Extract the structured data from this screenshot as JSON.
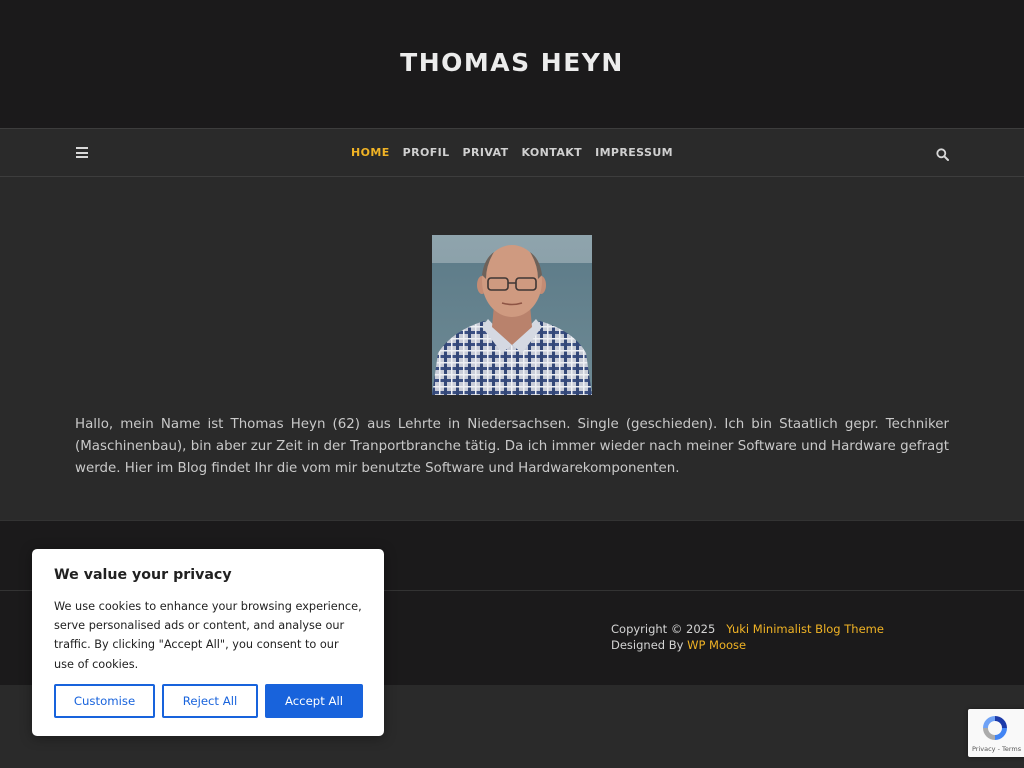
{
  "header": {
    "site_title": "THOMAS HEYN"
  },
  "nav": {
    "items": [
      {
        "label": "HOME",
        "active": true
      },
      {
        "label": "PROFIL",
        "active": false
      },
      {
        "label": "PRIVAT",
        "active": false
      },
      {
        "label": "KONTAKT",
        "active": false
      },
      {
        "label": "IMPRESSUM",
        "active": false
      }
    ],
    "menu_icon": "hamburger-menu-icon",
    "search_icon": "search-icon"
  },
  "main": {
    "intro": "Hallo, mein Name ist Thomas Heyn (62) aus Lehrte in Niedersachsen. Single (geschieden). Ich bin Staatlich gepr. Techniker (Maschinenbau), bin aber zur Zeit in der Tranportbranche tätig. Da ich immer wieder nach meiner Software und Hardware gefragt werde. Hier im Blog findet Ihr die vom mir benutzte Software und Hardwarekomponenten."
  },
  "footer": {
    "copyright_prefix": "Copyright © 2025",
    "theme_link": "Yuki Minimalist Blog Theme",
    "designed_text": "Designed By",
    "designer_link": "WP Moose"
  },
  "cookie": {
    "title": "We value your privacy",
    "text": "We use cookies to enhance your browsing experience, serve personalised ads or content, and analyse our traffic. By clicking \"Accept All\", you consent to our use of cookies.",
    "customise_label": "Customise",
    "reject_label": "Reject All",
    "accept_label": "Accept All"
  },
  "recaptcha": {
    "links": "Privacy - Terms"
  },
  "colors": {
    "accent": "#f0b325",
    "header_bg": "#1b1a1b",
    "body_bg": "#2a2a2a",
    "cookie_blue": "#1863dc"
  }
}
